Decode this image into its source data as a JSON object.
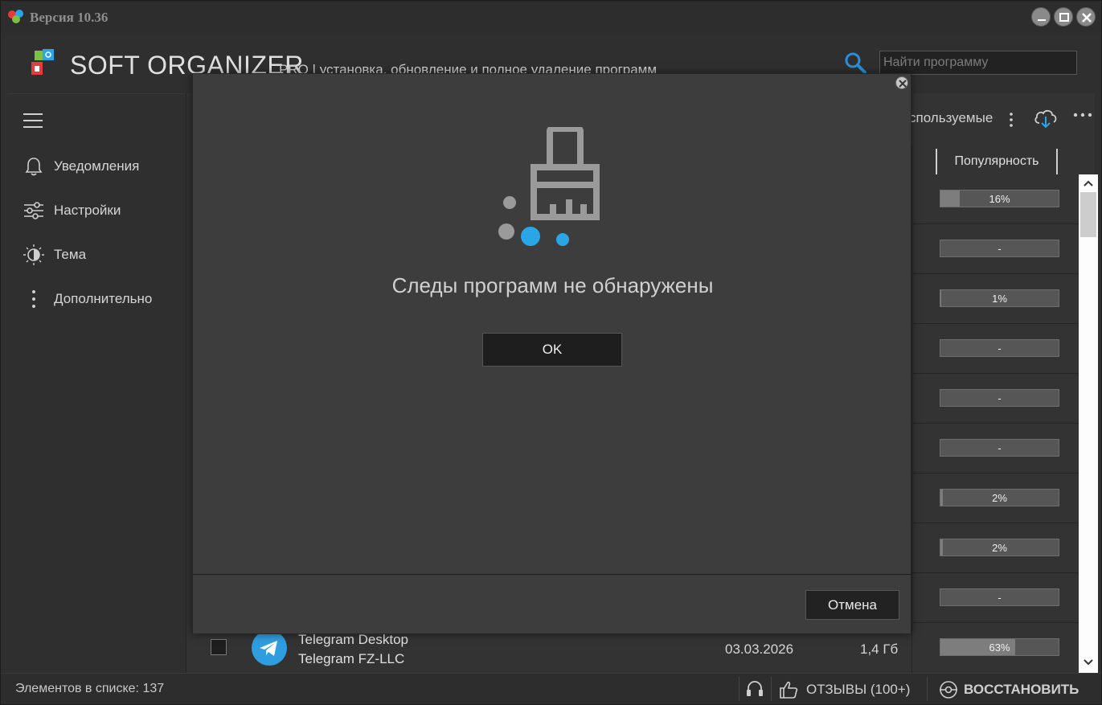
{
  "window": {
    "title": "Версия 10.36"
  },
  "header": {
    "brand": "SOFT ORGANIZER",
    "brand_sub": "PRO | установка, обновление и полное удаление программ",
    "search_placeholder": "Найти программу"
  },
  "sidebar": {
    "items": [
      {
        "label": "Уведомления",
        "icon": "bell-icon"
      },
      {
        "label": "Настройки",
        "icon": "sliders-icon"
      },
      {
        "label": "Тема",
        "icon": "theme-icon"
      },
      {
        "label": "Дополнительно",
        "icon": "kebab-icon"
      }
    ]
  },
  "toolbar": {
    "filter_label": "спользуемые"
  },
  "list": {
    "popularity_header": "Популярность",
    "popularity": [
      {
        "text": "16%",
        "fraction": 0.16
      },
      {
        "text": "-",
        "fraction": 0
      },
      {
        "text": "1%",
        "fraction": 0.01
      },
      {
        "text": "-",
        "fraction": 0
      },
      {
        "text": "-",
        "fraction": 0
      },
      {
        "text": "-",
        "fraction": 0
      },
      {
        "text": "2%",
        "fraction": 0.02
      },
      {
        "text": "2%",
        "fraction": 0.02
      },
      {
        "text": "-",
        "fraction": 0
      },
      {
        "text": "63%",
        "fraction": 0.63
      }
    ],
    "telegram": {
      "name": "Telegram Desktop",
      "publisher": "Telegram FZ-LLC",
      "date": "03.03.2026",
      "size": "1,4 Гб"
    }
  },
  "statusbar": {
    "count": "Элементов в списке: 137",
    "reviews": "ОТЗЫВЫ (100+)",
    "restore": "ВОССТАНОВИТЬ"
  },
  "modal": {
    "message": "Следы программ не обнаружены",
    "ok_label": "OK",
    "cancel_label": "Отмена"
  },
  "colors": {
    "accent_blue": "#2aa6e6",
    "background": "#2f2f2f",
    "modal_bg": "#3d3d3d"
  }
}
